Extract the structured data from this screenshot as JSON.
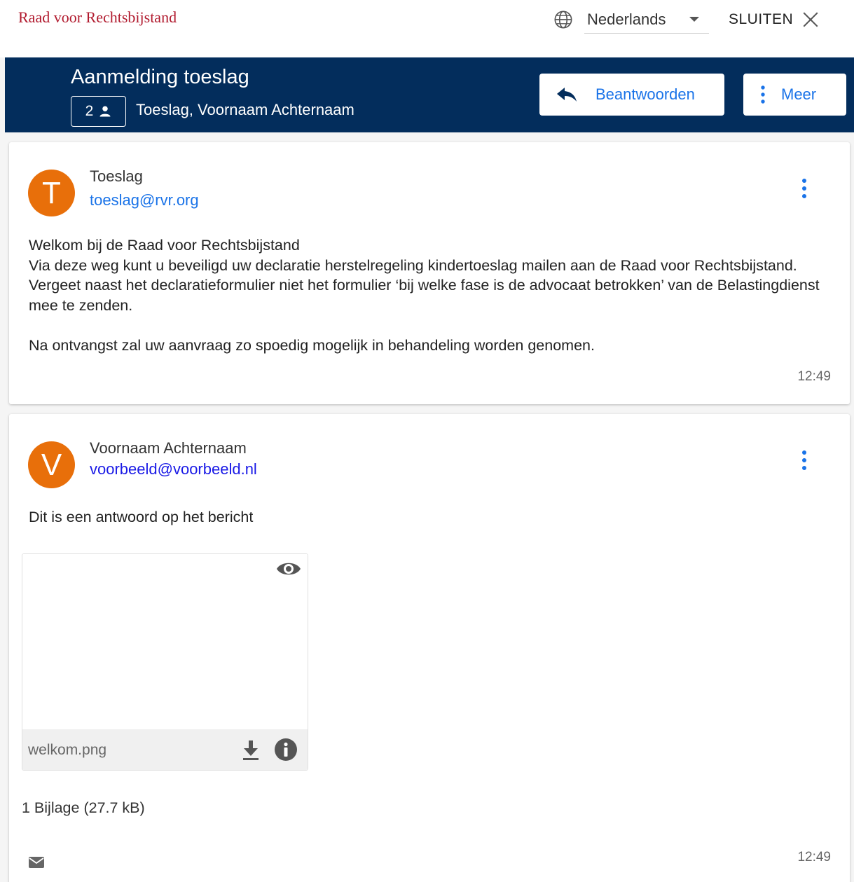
{
  "topbar": {
    "logo": "Raad voor Rechtsbijstand",
    "language": "Nederlands",
    "close_label": "SLUITEN"
  },
  "header": {
    "title": "Aanmelding toeslag",
    "participants_count": "2",
    "subtitle": "Toeslag, Voornaam Achternaam",
    "reply_label": "Beantwoorden",
    "more_label": "Meer"
  },
  "messages": [
    {
      "avatar_letter": "T",
      "sender": "Toeslag",
      "email": "toeslag@rvr.org",
      "body": [
        "Welkom bij de Raad voor Rechtsbijstand",
        "Via deze weg kunt u beveiligd uw declaratie herstelregeling kindertoeslag mailen aan de Raad voor Rechtsbijstand. Vergeet naast het declaratieformulier niet het formulier ‘bij welke fase is de advocaat betrokken’ van de Belastingdienst mee te zenden.",
        "Na ontvangst zal uw aanvraag zo spoedig mogelijk in behandeling worden genomen."
      ],
      "time": "12:49"
    },
    {
      "avatar_letter": "V",
      "sender": "Voornaam Achternaam",
      "email": "voorbeeld@voorbeeld.nl",
      "body": "Dit is een antwoord op het bericht",
      "attachment_name": "welkom.png",
      "attachment_summary": "1 Bijlage (27.7 kB)",
      "time": "12:49"
    }
  ],
  "icons": {
    "language": "globe-icon",
    "close": "close-icon",
    "participants": "person-icon",
    "reply": "reply-icon",
    "more": "more-vertical-icon",
    "preview": "eye-icon",
    "download": "download-icon",
    "info": "info-icon",
    "mail": "mail-icon"
  },
  "colors": {
    "header_bg": "#032d5c",
    "accent_blue": "#1a73e8",
    "avatar_orange": "#e86f0a",
    "logo_red": "#b11a2e",
    "email_link_1": "#1a73e8",
    "email_link_2": "#1a1ae6"
  }
}
